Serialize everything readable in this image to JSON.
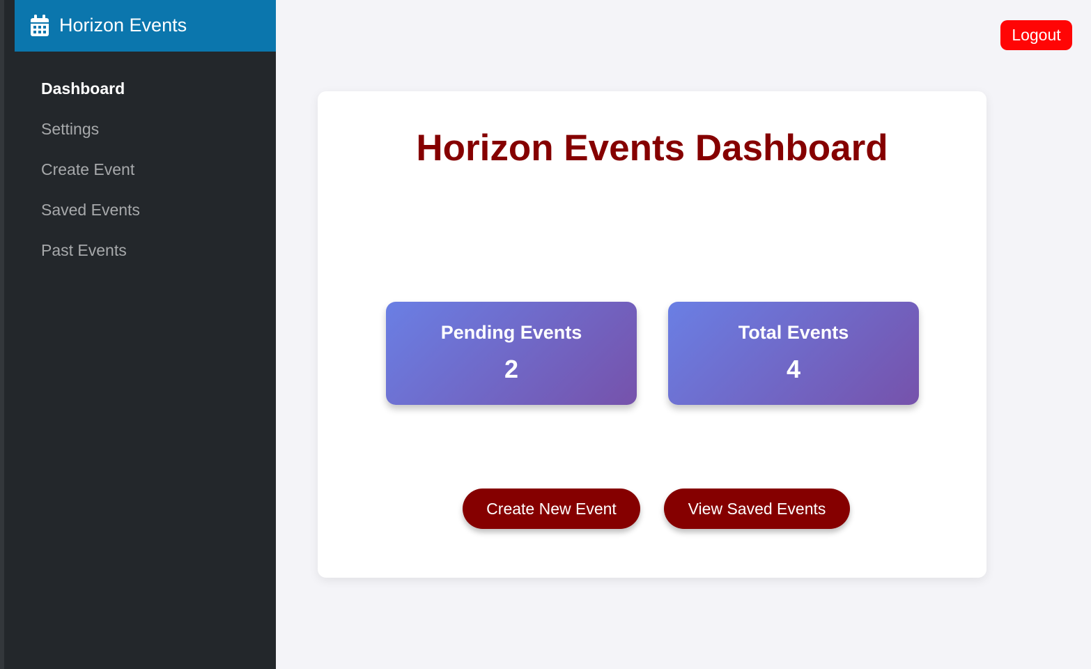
{
  "sidebar": {
    "brand": {
      "title": "Horizon Events",
      "icon": "calendar-icon",
      "background": "#0b76ad"
    },
    "items": [
      {
        "label": "Dashboard",
        "active": true
      },
      {
        "label": "Settings",
        "active": false
      },
      {
        "label": "Create Event",
        "active": false
      },
      {
        "label": "Saved Events",
        "active": false
      },
      {
        "label": "Past Events",
        "active": false
      }
    ],
    "background": "#23272b"
  },
  "header": {
    "logout_label": "Logout",
    "logout_color": "#ff0505"
  },
  "main": {
    "title": "Horizon Events Dashboard",
    "title_color": "#850000",
    "stats": [
      {
        "label": "Pending Events",
        "value": "2"
      },
      {
        "label": "Total Events",
        "value": "4"
      }
    ],
    "actions": {
      "create_label": "Create New Event",
      "view_label": "View Saved Events",
      "color": "#850000"
    }
  }
}
